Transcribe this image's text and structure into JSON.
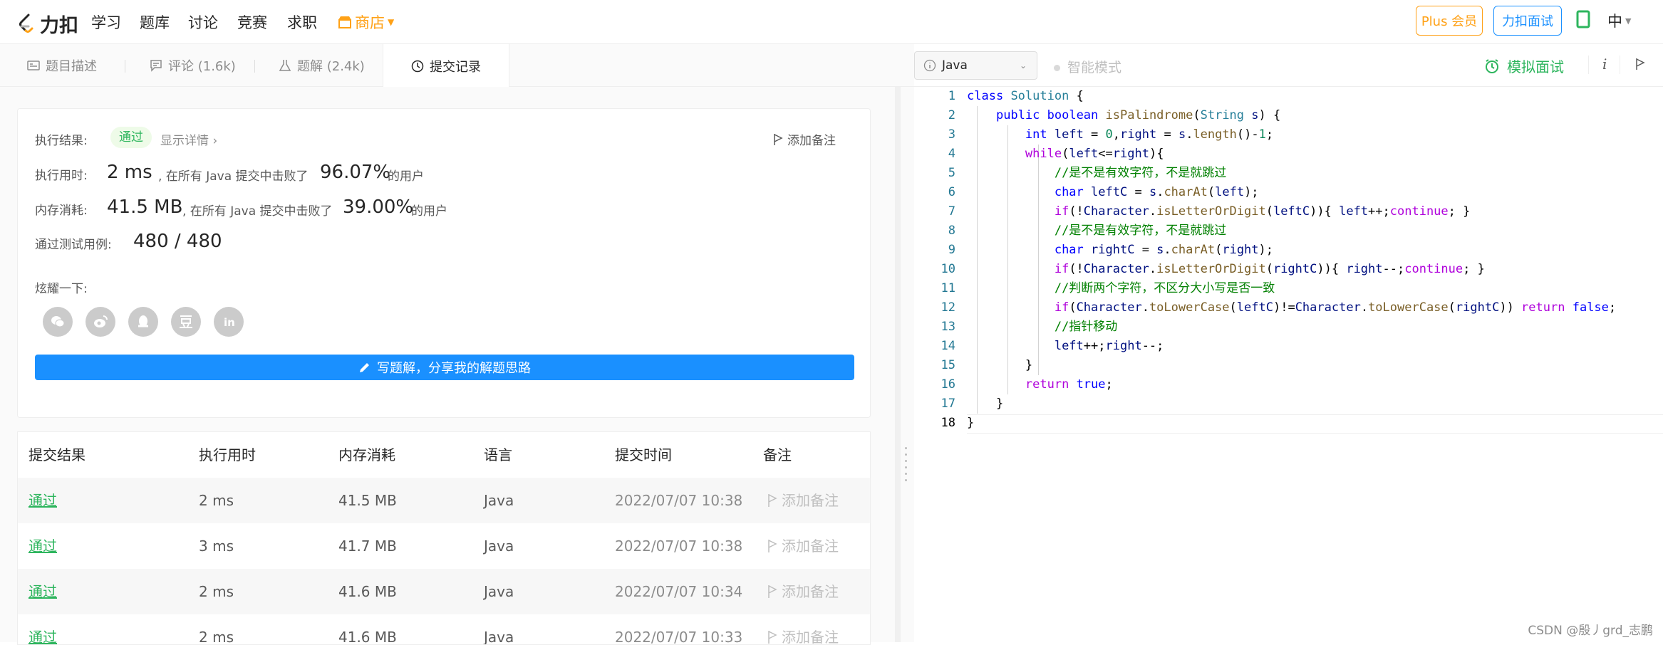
{
  "nav": {
    "logo_text": "力扣",
    "items": [
      "学习",
      "题库",
      "讨论",
      "竞赛",
      "求职"
    ],
    "store": "商店",
    "plus": "Plus 会员",
    "interview": "力扣面试",
    "lang": "中"
  },
  "tabs": [
    {
      "label": "题目描述"
    },
    {
      "label": "评论 (1.6k)"
    },
    {
      "label": "题解 (2.4k)"
    },
    {
      "label": "提交记录"
    }
  ],
  "result": {
    "status_label": "执行结果:",
    "status": "通过",
    "show_detail": "显示详情 ›",
    "add_note": "添加备注",
    "runtime_label": "执行用时:",
    "runtime": "2 ms",
    "runtime_text": ", 在所有 Java 提交中击败了",
    "runtime_pct": "96.07%",
    "users": "的用户",
    "memory_label": "内存消耗:",
    "memory": "41.5 MB",
    "memory_text": ", 在所有 Java 提交中击败了",
    "memory_pct": "39.00%",
    "tests_label": "通过测试用例:",
    "tests": "480 / 480",
    "share_label": "炫耀一下:",
    "write_solution": "写题解，分享我的解题思路"
  },
  "table": {
    "headers": [
      "提交结果",
      "执行用时",
      "内存消耗",
      "语言",
      "提交时间",
      "备注"
    ],
    "rows": [
      {
        "status": "通过",
        "time": "2 ms",
        "mem": "41.5 MB",
        "lang": "Java",
        "date": "2022/07/07 10:38",
        "note": "添加备注"
      },
      {
        "status": "通过",
        "time": "3 ms",
        "mem": "41.7 MB",
        "lang": "Java",
        "date": "2022/07/07 10:38",
        "note": "添加备注"
      },
      {
        "status": "通过",
        "time": "2 ms",
        "mem": "41.6 MB",
        "lang": "Java",
        "date": "2022/07/07 10:34",
        "note": "添加备注"
      },
      {
        "status": "通过",
        "time": "2 ms",
        "mem": "41.6 MB",
        "lang": "Java",
        "date": "2022/07/07 10:33",
        "note": "添加备注"
      }
    ]
  },
  "editor": {
    "language": "Java",
    "smart_mode": "智能模式",
    "mock_interview": "模拟面试",
    "line_numbers": [
      "1",
      "2",
      "3",
      "4",
      "5",
      "6",
      "7",
      "8",
      "9",
      "10",
      "11",
      "12",
      "13",
      "14",
      "15",
      "16",
      "17",
      "18"
    ]
  },
  "watermark": "CSDN @殷丿grd_志鹏"
}
